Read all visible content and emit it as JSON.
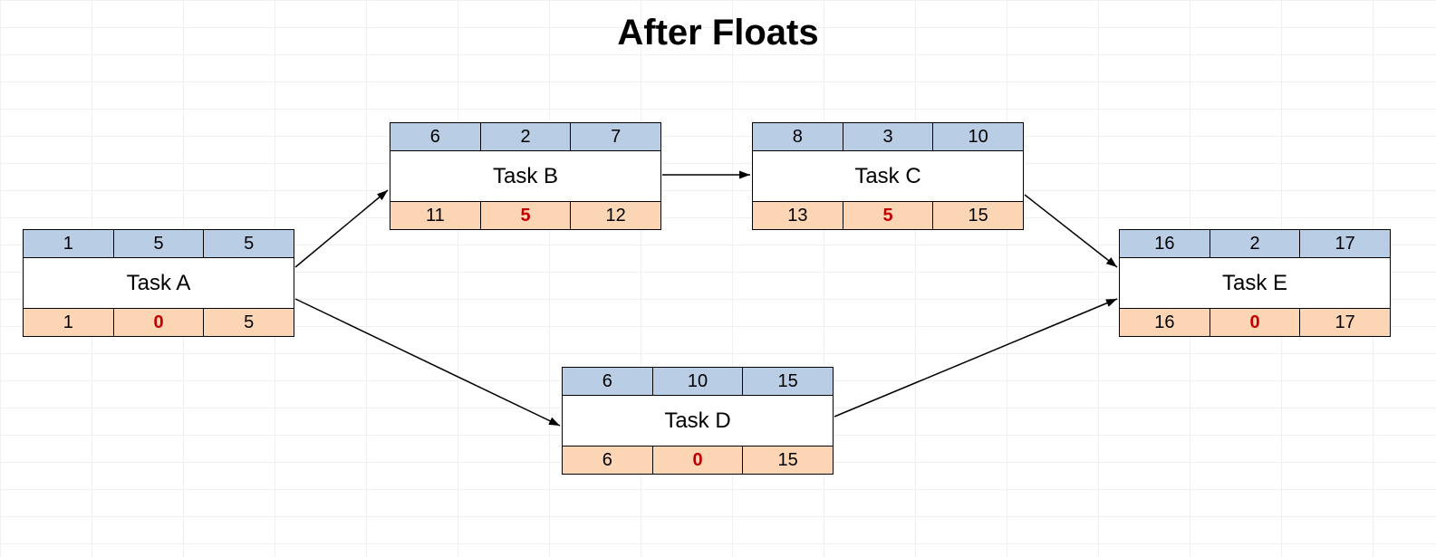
{
  "title": "After Floats",
  "tasks": {
    "A": {
      "name": "Task A",
      "es": "1",
      "dur": "5",
      "ef": "5",
      "ls": "1",
      "float": "0",
      "lf": "5"
    },
    "B": {
      "name": "Task B",
      "es": "6",
      "dur": "2",
      "ef": "7",
      "ls": "11",
      "float": "5",
      "lf": "12"
    },
    "C": {
      "name": "Task C",
      "es": "8",
      "dur": "3",
      "ef": "10",
      "ls": "13",
      "float": "5",
      "lf": "15"
    },
    "D": {
      "name": "Task D",
      "es": "6",
      "dur": "10",
      "ef": "15",
      "ls": "6",
      "float": "0",
      "lf": "15"
    },
    "E": {
      "name": "Task E",
      "es": "16",
      "dur": "2",
      "ef": "17",
      "ls": "16",
      "float": "0",
      "lf": "17"
    }
  }
}
